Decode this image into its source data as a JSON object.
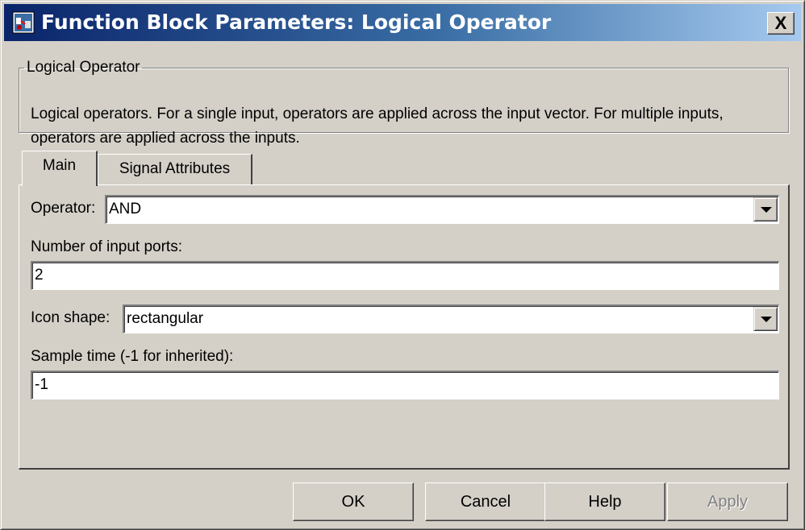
{
  "window": {
    "title": "Function Block Parameters: Logical Operator",
    "close_label": "X"
  },
  "description_group": {
    "title": "Logical Operator",
    "text": "Logical operators.  For a single input, operators are applied across the input vector.  For multiple inputs, operators are applied across the inputs."
  },
  "tabs": [
    {
      "label": "Main",
      "selected": true
    },
    {
      "label": "Signal Attributes",
      "selected": false
    }
  ],
  "main": {
    "operator": {
      "label": "Operator:",
      "value": "AND"
    },
    "num_inputs": {
      "label": "Number of input ports:",
      "value": "2"
    },
    "icon_shape": {
      "label": "Icon shape:",
      "value": "rectangular"
    },
    "sample_time": {
      "label": "Sample time (-1 for inherited):",
      "value": "-1"
    }
  },
  "buttons": {
    "ok": "OK",
    "cancel": "Cancel",
    "help": "Help",
    "apply": "Apply"
  }
}
